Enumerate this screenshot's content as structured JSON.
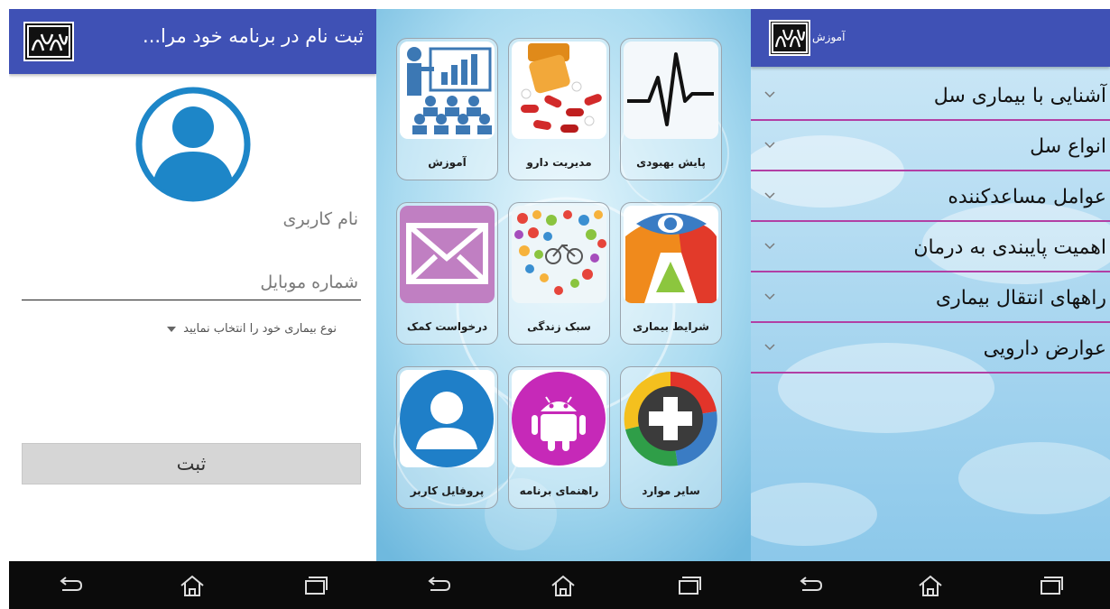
{
  "register": {
    "app_title": "ثبت نام در برنامه خود مرا...",
    "username_label": "نام کاربری",
    "mobile_label": "شماره موبایل",
    "disease_spinner": "نوع بیماری خود را انتخاب نمایید",
    "submit_label": "ثبت"
  },
  "dashboard": {
    "tiles": [
      {
        "label": "پایش بهبودی",
        "icon": "heartbeat-icon"
      },
      {
        "label": "مدیریت دارو",
        "icon": "pills-icon"
      },
      {
        "label": "آموزش",
        "icon": "classroom-icon"
      },
      {
        "label": "شرایط بیماری",
        "icon": "eye-logo-icon"
      },
      {
        "label": "سبک زندگی",
        "icon": "lifestyle-icon"
      },
      {
        "label": "درخواست کمک",
        "icon": "envelope-icon"
      },
      {
        "label": "سایر موارد",
        "icon": "plus-icon"
      },
      {
        "label": "راهنمای برنامه",
        "icon": "android-icon"
      },
      {
        "label": "پروفایل کاربر",
        "icon": "user-profile-icon"
      }
    ]
  },
  "education": {
    "title": "آموزش",
    "items": [
      "آشنایی با بیماری سل",
      "انواع سل",
      "عوامل مساعدکننده",
      "اهمیت پایبندی به درمان",
      "راههای انتقال بیماری",
      "عوارض دارویی"
    ]
  },
  "colors": {
    "appbar": "#3f51b5",
    "divider": "#b23fa4",
    "navbar": "#0b0b0b"
  }
}
